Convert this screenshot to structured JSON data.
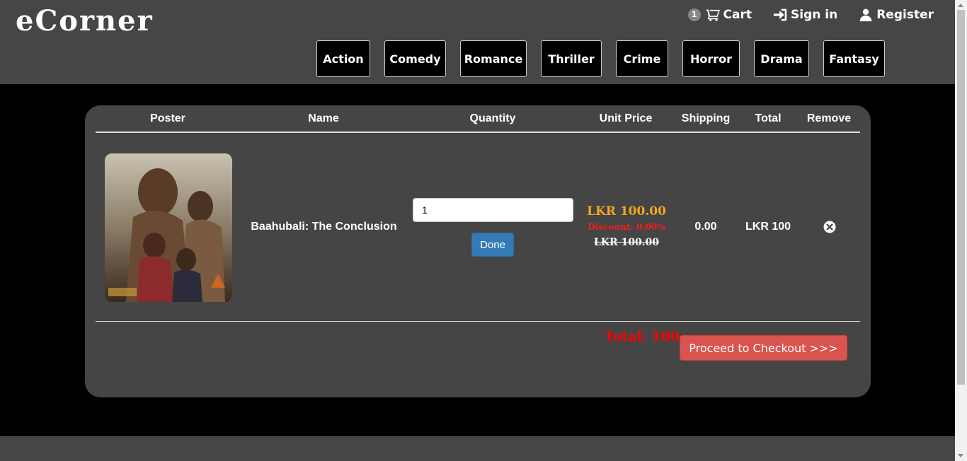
{
  "header": {
    "logo": "eCorner",
    "cart_count": "1",
    "cart_label": "Cart",
    "signin_label": "Sign in",
    "register_label": "Register"
  },
  "genres": [
    "Action",
    "Comedy",
    "Romance",
    "Thriller",
    "Crime",
    "Horror",
    "Drama",
    "Fantasy"
  ],
  "cart": {
    "columns": {
      "poster": "Poster",
      "name": "Name",
      "quantity": "Quantity",
      "unit_price": "Unit Price",
      "shipping": "Shipping",
      "total": "Total",
      "remove": "Remove"
    },
    "item": {
      "name": "Baahubali: The Conclusion",
      "quantity": "1",
      "done_label": "Done",
      "price": "LKR 100.00",
      "discount": "Discount: 0.00%",
      "original_price": "LKR 100.00",
      "shipping": "0.00",
      "total": "LKR 100"
    },
    "grand_total": "Total: 100",
    "checkout_label": "Proceed to Checkout >>>"
  },
  "colors": {
    "header_bg": "#464646",
    "panel_bg": "#454545",
    "price": "#f5a623",
    "discount": "#ff1a1a",
    "total": "#ff0000",
    "checkout": "#d9534f",
    "done": "#337ab7"
  },
  "icons": {
    "cart": "shopping-cart-icon",
    "signin": "sign-in-icon",
    "register": "user-icon",
    "remove": "remove-circle-icon"
  }
}
